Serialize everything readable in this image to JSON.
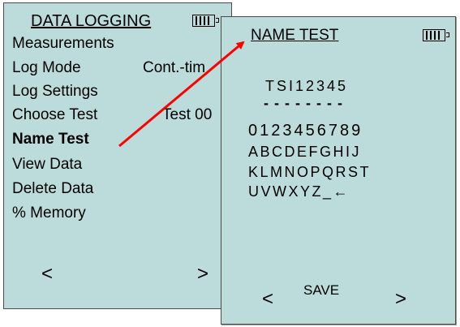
{
  "left_screen": {
    "title": "DATA LOGGING",
    "menu": [
      {
        "label": "Measurements",
        "value": ""
      },
      {
        "label": "Log Mode",
        "value": "Cont.-tim"
      },
      {
        "label": "Log Settings",
        "value": ""
      },
      {
        "label": "Choose Test",
        "value": "Test 00"
      },
      {
        "label": "Name Test",
        "value": ""
      },
      {
        "label": "View Data",
        "value": ""
      },
      {
        "label": "Delete Data",
        "value": ""
      },
      {
        "label": "% Memory",
        "value": ""
      }
    ],
    "nav_left": "<",
    "nav_right": ">"
  },
  "right_screen": {
    "title": "NAME TEST",
    "test_name": "TSI12345",
    "cursor_dashes": "- - - - - - - -",
    "char_rows": [
      "0123456789",
      "ABCDEFGHIJ",
      "KLMNOPQRST",
      "UVWXYZ_←"
    ],
    "save_label": "SAVE",
    "nav_left": "<",
    "nav_right": ">"
  },
  "annotation": {
    "arrow_color": "#ff0000"
  }
}
